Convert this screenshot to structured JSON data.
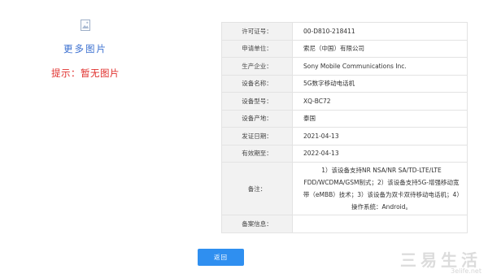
{
  "left": {
    "image_icon": "image-placeholder-icon",
    "more_images": "更多图片",
    "hint": "提示：暂无图片"
  },
  "details": [
    {
      "label": "许可证号：",
      "value": "00-D810-218411"
    },
    {
      "label": "申请单位：",
      "value": "索尼（中国）有限公司"
    },
    {
      "label": "生产企业：",
      "value": "Sony Mobile Communications Inc."
    },
    {
      "label": "设备名称：",
      "value": "5G数字移动电话机"
    },
    {
      "label": "设备型号：",
      "value": "XQ-BC72"
    },
    {
      "label": "设备产地：",
      "value": "泰国"
    },
    {
      "label": "发证日期：",
      "value": "2021-04-13"
    },
    {
      "label": "有效期至：",
      "value": "2022-04-13"
    },
    {
      "label": "备注：",
      "value": "1）该设备支持NR NSA/NR SA/TD-LTE/LTE FDD/WCDMA/GSM制式；2）该设备支持5G-增强移动宽带（eMBB）技术；3）该设备为双卡双待移动电话机；4）操作系统：Android。"
    },
    {
      "label": "备案信息：",
      "value": ""
    }
  ],
  "back_button": "返回",
  "watermark": {
    "main": "三易生活",
    "sub": "3elife.net"
  },
  "colors": {
    "link": "#3a6fd0",
    "hint": "#e0302d",
    "button": "#2f8ff0",
    "label_bg": "#f2f2f2"
  }
}
